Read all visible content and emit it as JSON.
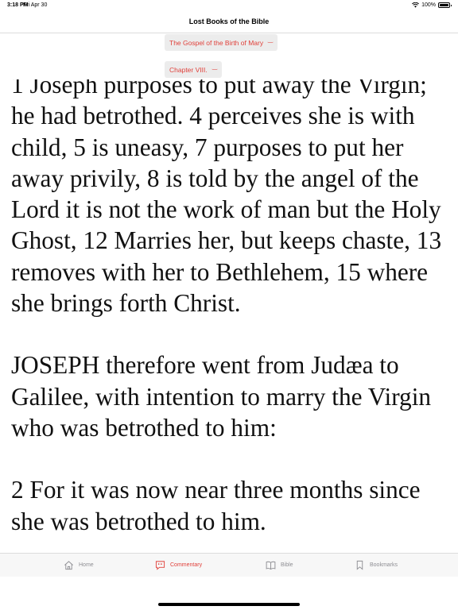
{
  "status_bar": {
    "time": "3:18 PM",
    "date": "Fri Apr 30",
    "battery_text": "100%",
    "battery_level": 1.0,
    "icons": [
      "wifi-icon",
      "battery-icon"
    ]
  },
  "nav": {
    "title": "Lost Books of the Bible"
  },
  "selectors": {
    "book": "The Gospel of the Birth of Mary",
    "chapter": "Chapter VIII."
  },
  "content": {
    "paragraphs": [
      "1 Joseph purposes to put away the Virgin; he had betrothed. 4 perceives she is with child, 5 is uneasy, 7 purposes to put her away privily, 8 is told by the angel of the Lord it is not the work of man but the Holy Ghost, 12 Marries her, but keeps chaste, 13 removes with her to Bethlehem, 15 where she brings forth Christ.",
      "JOSEPH therefore went from Judæa to Galilee, with intention to marry the Virgin who was betrothed to him:",
      "2 For it was now near three months since she was betrothed to him."
    ]
  },
  "tabs": [
    {
      "label": "Home",
      "icon": "home-icon",
      "active": false
    },
    {
      "label": "Commentary",
      "icon": "commentary-icon",
      "active": true
    },
    {
      "label": "Bible",
      "icon": "book-icon",
      "active": false
    },
    {
      "label": "Bookmarks",
      "icon": "bookmark-icon",
      "active": false
    }
  ],
  "colors": {
    "accent": "#e0403a",
    "inactive": "#8e8e93",
    "selector_bg": "#ececec"
  }
}
